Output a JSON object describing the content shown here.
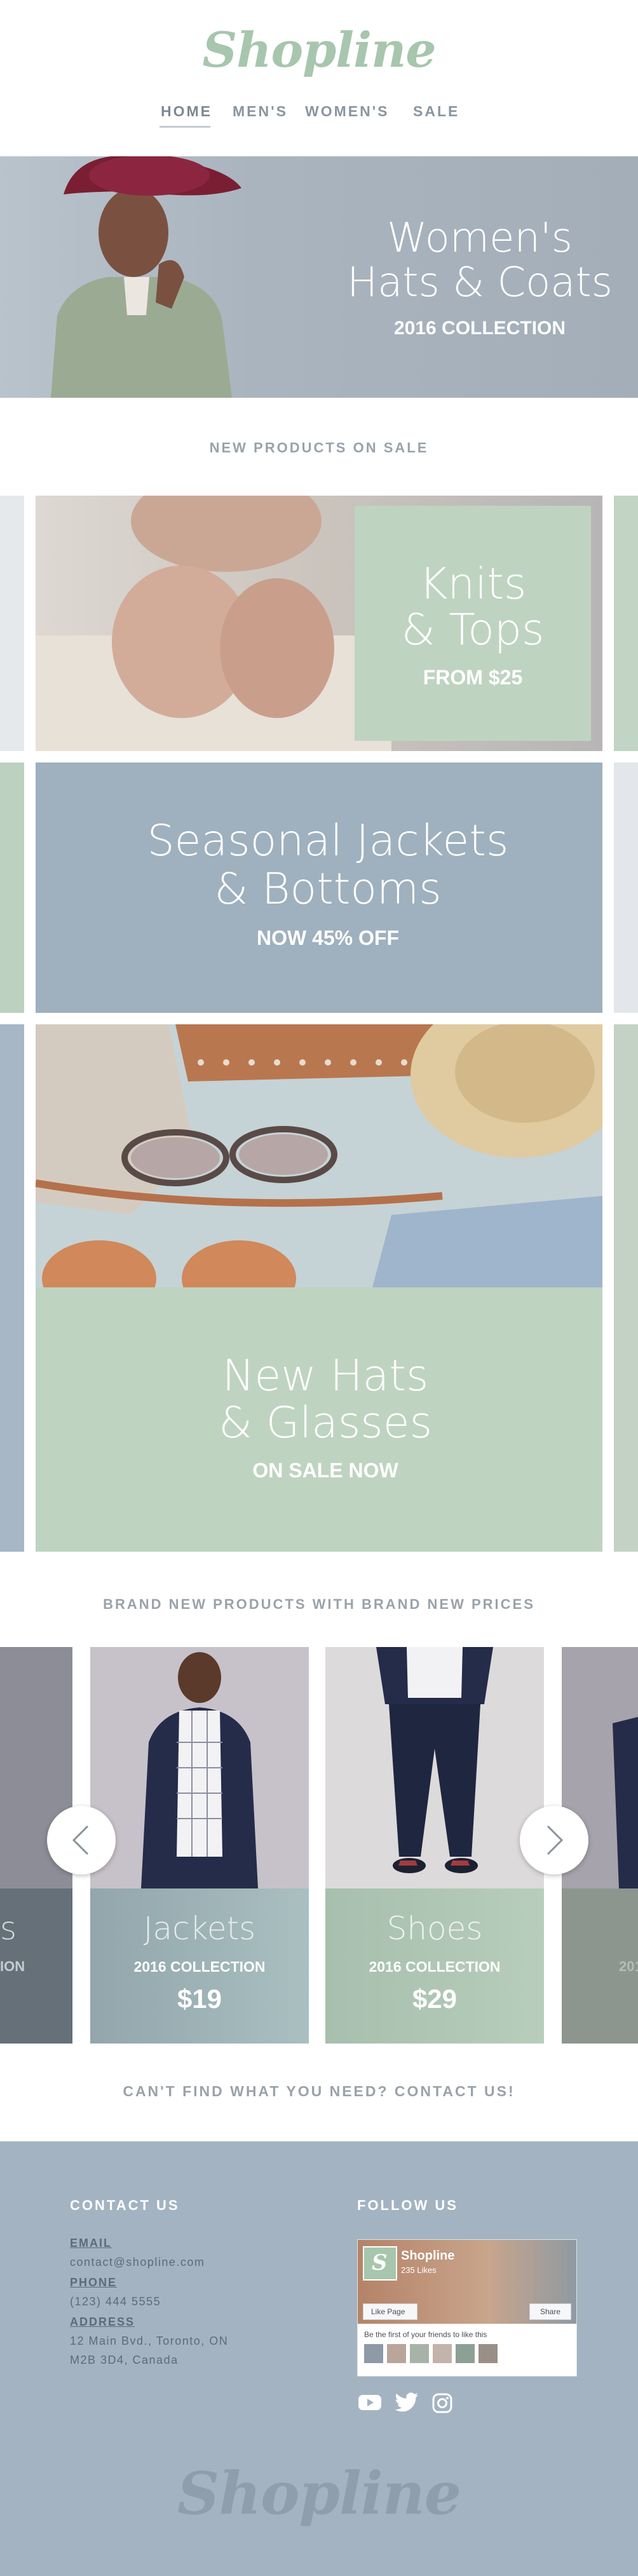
{
  "brand": {
    "logo": "Shopline"
  },
  "nav": {
    "items": [
      "HOME",
      "MEN'S",
      "WOMEN'S",
      "SALE"
    ]
  },
  "hero": {
    "line1": "Women's",
    "line2": "Hats & Coats",
    "sub": "2016 COLLECTION"
  },
  "section1": {
    "title": "NEW PRODUCTS ON SALE"
  },
  "promo1": {
    "line1": "Knits",
    "line2": "& Tops",
    "sub": "FROM $25"
  },
  "promo2": {
    "line1": "Seasonal Jackets",
    "line2": "& Bottoms",
    "sub": "NOW 45% OFF"
  },
  "promo3": {
    "line1": "New Hats",
    "line2": "& Glasses",
    "sub": "ON SALE NOW"
  },
  "section2": {
    "title": "BRAND NEW PRODUCTS WITH BRAND NEW PRICES"
  },
  "carousel": {
    "left_partial": {
      "title": "s",
      "sub": "ION"
    },
    "right_partial": {
      "sub": "201"
    },
    "cards": [
      {
        "title": "Jackets",
        "sub": "2016 COLLECTION",
        "price": "$19"
      },
      {
        "title": "Shoes",
        "sub": "2016 COLLECTION",
        "price": "$29"
      }
    ]
  },
  "contact_cta": "CAN'T FIND WHAT YOU NEED? CONTACT US!",
  "footer": {
    "contact_title": "CONTACT US",
    "email_label": "EMAIL",
    "email": "contact@shopline.com",
    "phone_label": "PHONE",
    "phone": "(123) 444 5555",
    "address_label": "ADDRESS",
    "address1": "12 Main Bvd., Toronto, ON",
    "address2": "M2B 3D4, Canada",
    "follow_title": "FOLLOW US",
    "fb": {
      "name": "Shopline",
      "likes": "235 Likes",
      "like_btn": "Like Page",
      "share_btn": "Share",
      "friends": "Be the first of your friends to like this"
    },
    "logo": "Shopline"
  },
  "colors": {
    "sage": "#bfd3c1",
    "blue": "#9fb0be",
    "footer": "#a3b3c1",
    "logo": "#a7c6ad"
  }
}
